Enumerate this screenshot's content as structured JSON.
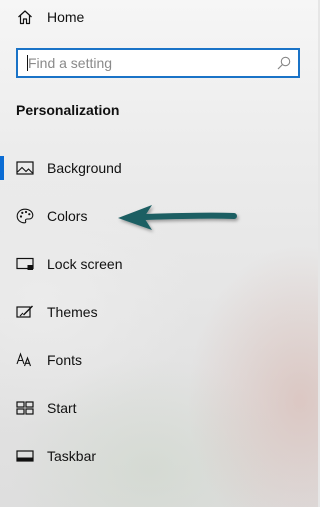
{
  "home": {
    "label": "Home",
    "icon": "home-icon"
  },
  "search": {
    "placeholder": "Find a setting",
    "icon": "search-icon",
    "accent": "#1a73c7"
  },
  "section": {
    "title": "Personalization"
  },
  "nav": {
    "selected": "Background",
    "accent": "#0b6cd4",
    "items": [
      {
        "label": "Background",
        "icon": "picture-icon"
      },
      {
        "label": "Colors",
        "icon": "palette-icon"
      },
      {
        "label": "Lock screen",
        "icon": "lock-screen-icon"
      },
      {
        "label": "Themes",
        "icon": "themes-icon"
      },
      {
        "label": "Fonts",
        "icon": "fonts-icon"
      },
      {
        "label": "Start",
        "icon": "start-icon"
      },
      {
        "label": "Taskbar",
        "icon": "taskbar-icon"
      }
    ]
  },
  "annotation": {
    "icon": "pointer-arrow-icon",
    "color": "#1f5f63",
    "points_to": "Colors"
  }
}
